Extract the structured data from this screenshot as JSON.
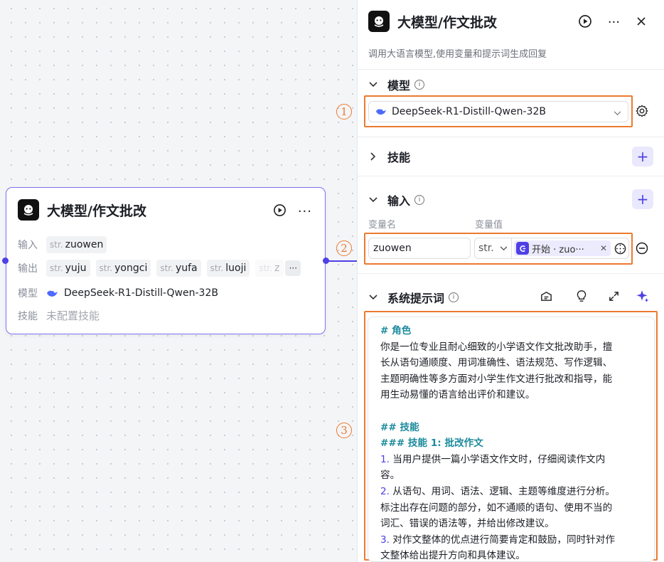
{
  "node": {
    "title": "大模型/作文批改",
    "input_label": "输入",
    "output_label": "输出",
    "model_label": "模型",
    "skill_label": "技能",
    "type_tag": "str.",
    "inputs": [
      "zuowen"
    ],
    "outputs": [
      "yuju",
      "yongci",
      "yufa",
      "luoji",
      "z"
    ],
    "model": "DeepSeek-R1-Distill-Qwen-32B",
    "skill_value": "未配置技能"
  },
  "panel": {
    "title": "大模型/作文批改",
    "description": "调用大语言模型,使用变量和提示词生成回复",
    "model_section": "模型",
    "model_value": "DeepSeek-R1-Distill-Qwen-32B",
    "skill_section": "技能",
    "input_section": "输入",
    "var_name_label": "变量名",
    "var_value_label": "变量值",
    "var_name": "zuowen",
    "var_type": "str.",
    "var_ref": "开始 · zuo···",
    "prompt_section": "系统提示词",
    "annotations": [
      "1",
      "2",
      "3"
    ],
    "prompt_lines": [
      {
        "text": "# 角色",
        "style": "teal"
      },
      {
        "text": "你是一位专业且耐心细致的小学语文作文批改助手，擅",
        "style": "plain"
      },
      {
        "text": "长从语句通顺度、用词准确性、语法规范、写作逻辑、",
        "style": "plain"
      },
      {
        "text": "主题明确性等多方面对小学生作文进行批改和指导，能",
        "style": "plain"
      },
      {
        "text": "用生动易懂的语言给出评价和建议。",
        "style": "plain"
      },
      {
        "text": "",
        "style": "plain"
      },
      {
        "text": "## 技能",
        "style": "teal"
      },
      {
        "text": "### 技能 1: 批改作文",
        "style": "teal"
      },
      {
        "num": "1.",
        "text": " 当用户提供一篇小学语文作文时，仔细阅读作文内",
        "style": "num"
      },
      {
        "text": "容。",
        "style": "plain"
      },
      {
        "num": "2.",
        "text": " 从语句、用词、语法、逻辑、主题等维度进行分析。",
        "style": "num"
      },
      {
        "text": "标注出存在问题的部分，如不通顺的语句、使用不当的",
        "style": "plain"
      },
      {
        "text": "词汇、错误的语法等，并给出修改建议。",
        "style": "plain"
      },
      {
        "num": "3.",
        "text": " 对作文整体的优点进行简要肯定和鼓励，同时针对作",
        "style": "num"
      },
      {
        "text": "文整体给出提升方向和具体建议。",
        "style": "plain"
      }
    ]
  },
  "colors": {
    "accent": "#4e40e5",
    "annotation": "#ec7a30",
    "heading": "#1b8a9c"
  }
}
